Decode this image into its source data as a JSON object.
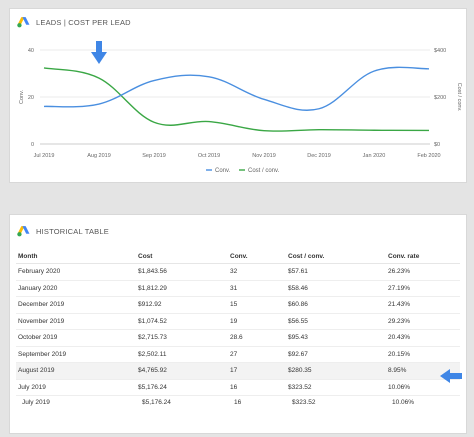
{
  "colors": {
    "conv": "#4a8fe0",
    "cost_per_conv": "#3aa745",
    "arrow": "#3f86e6"
  },
  "chart_card": {
    "title": "LEADS | COST PER LEAD"
  },
  "table_card": {
    "title": "HISTORICAL TABLE"
  },
  "chart_data": {
    "type": "line",
    "x": [
      "Jul 2019",
      "Aug 2019",
      "Sep 2019",
      "Oct 2019",
      "Nov 2019",
      "Dec 2019",
      "Jan 2020",
      "Feb 2020"
    ],
    "series": [
      {
        "name": "Conv.",
        "axis": "left",
        "values": [
          16,
          17,
          27,
          28.6,
          19,
          15,
          31,
          32
        ]
      },
      {
        "name": "Cost / conv.",
        "axis": "right",
        "values": [
          323.52,
          280.35,
          92.67,
          95.43,
          56.55,
          60.86,
          58.46,
          57.61
        ]
      }
    ],
    "left_axis": {
      "label": "Conv.",
      "ticks": [
        "0",
        "20",
        "40"
      ],
      "ylim": [
        0,
        40
      ]
    },
    "right_axis": {
      "label": "Cost / conv.",
      "ticks": [
        "$0",
        "$200",
        "$400"
      ],
      "ylim": [
        0,
        400
      ]
    },
    "legend_position": "bottom-center",
    "grid": "horizontal"
  },
  "table": {
    "headers": [
      "Month",
      "Cost",
      "Conv.",
      "Cost / conv.",
      "Conv. rate"
    ],
    "rows": [
      [
        "February 2020",
        "$1,843.56",
        "32",
        "$57.61",
        "26.23%"
      ],
      [
        "January 2020",
        "$1,812.29",
        "31",
        "$58.46",
        "27.19%"
      ],
      [
        "December 2019",
        "$912.92",
        "15",
        "$60.86",
        "21.43%"
      ],
      [
        "November 2019",
        "$1,074.52",
        "19",
        "$56.55",
        "29.23%"
      ],
      [
        "October 2019",
        "$2,715.73",
        "28.6",
        "$95.43",
        "20.43%"
      ],
      [
        "September 2019",
        "$2,502.11",
        "27",
        "$92.67",
        "20.15%"
      ],
      [
        "August 2019",
        "$4,765.92",
        "17",
        "$280.35",
        "8.95%"
      ],
      [
        "July 2019",
        "$5,176.24",
        "16",
        "$323.52",
        "10.06%"
      ],
      [
        "July 2019",
        "$5,176.24",
        "16",
        "$323.52",
        "10.06%"
      ]
    ]
  }
}
